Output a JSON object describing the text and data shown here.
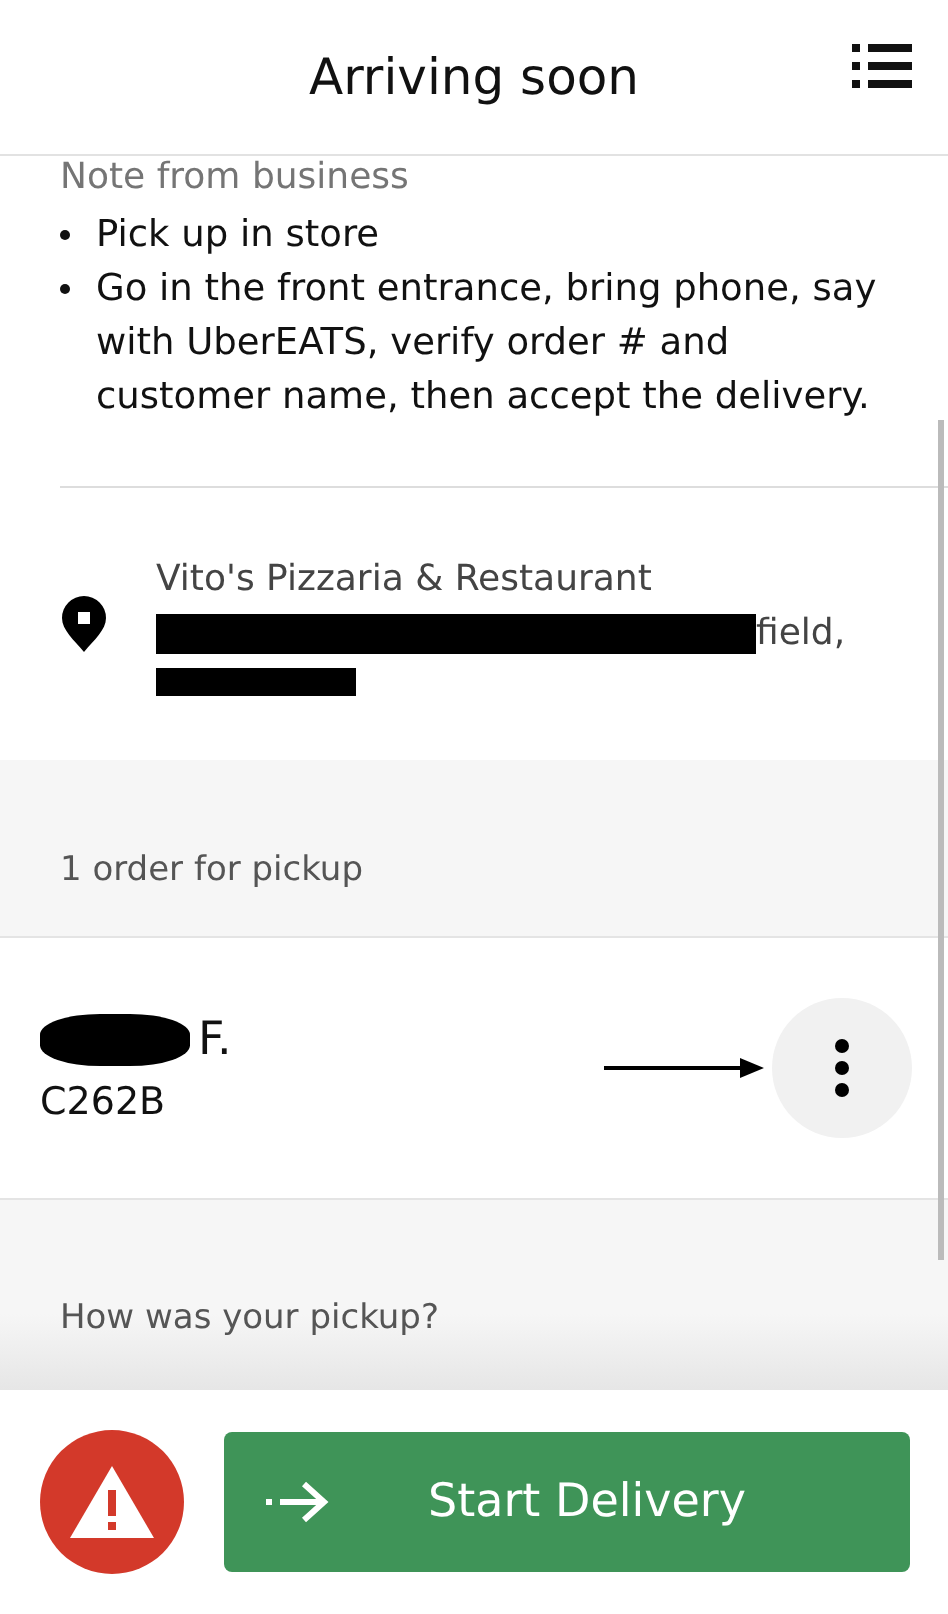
{
  "header": {
    "title": "Arriving soon"
  },
  "note": {
    "heading": "Note from business",
    "items": [
      "Pick up in store",
      "Go in the front entrance, bring phone, say with UberEATS, verify order # and customer name, then accept the delivery."
    ]
  },
  "location": {
    "name": "Vito's Pizzaria & Restaurant",
    "address_visible": "field,"
  },
  "pickup_section": {
    "label": "1 order for pickup"
  },
  "order": {
    "customer_visible": "F.",
    "code": "C262B"
  },
  "feedback": {
    "label": "How was your pickup?"
  },
  "footer": {
    "button": "Start Delivery"
  }
}
